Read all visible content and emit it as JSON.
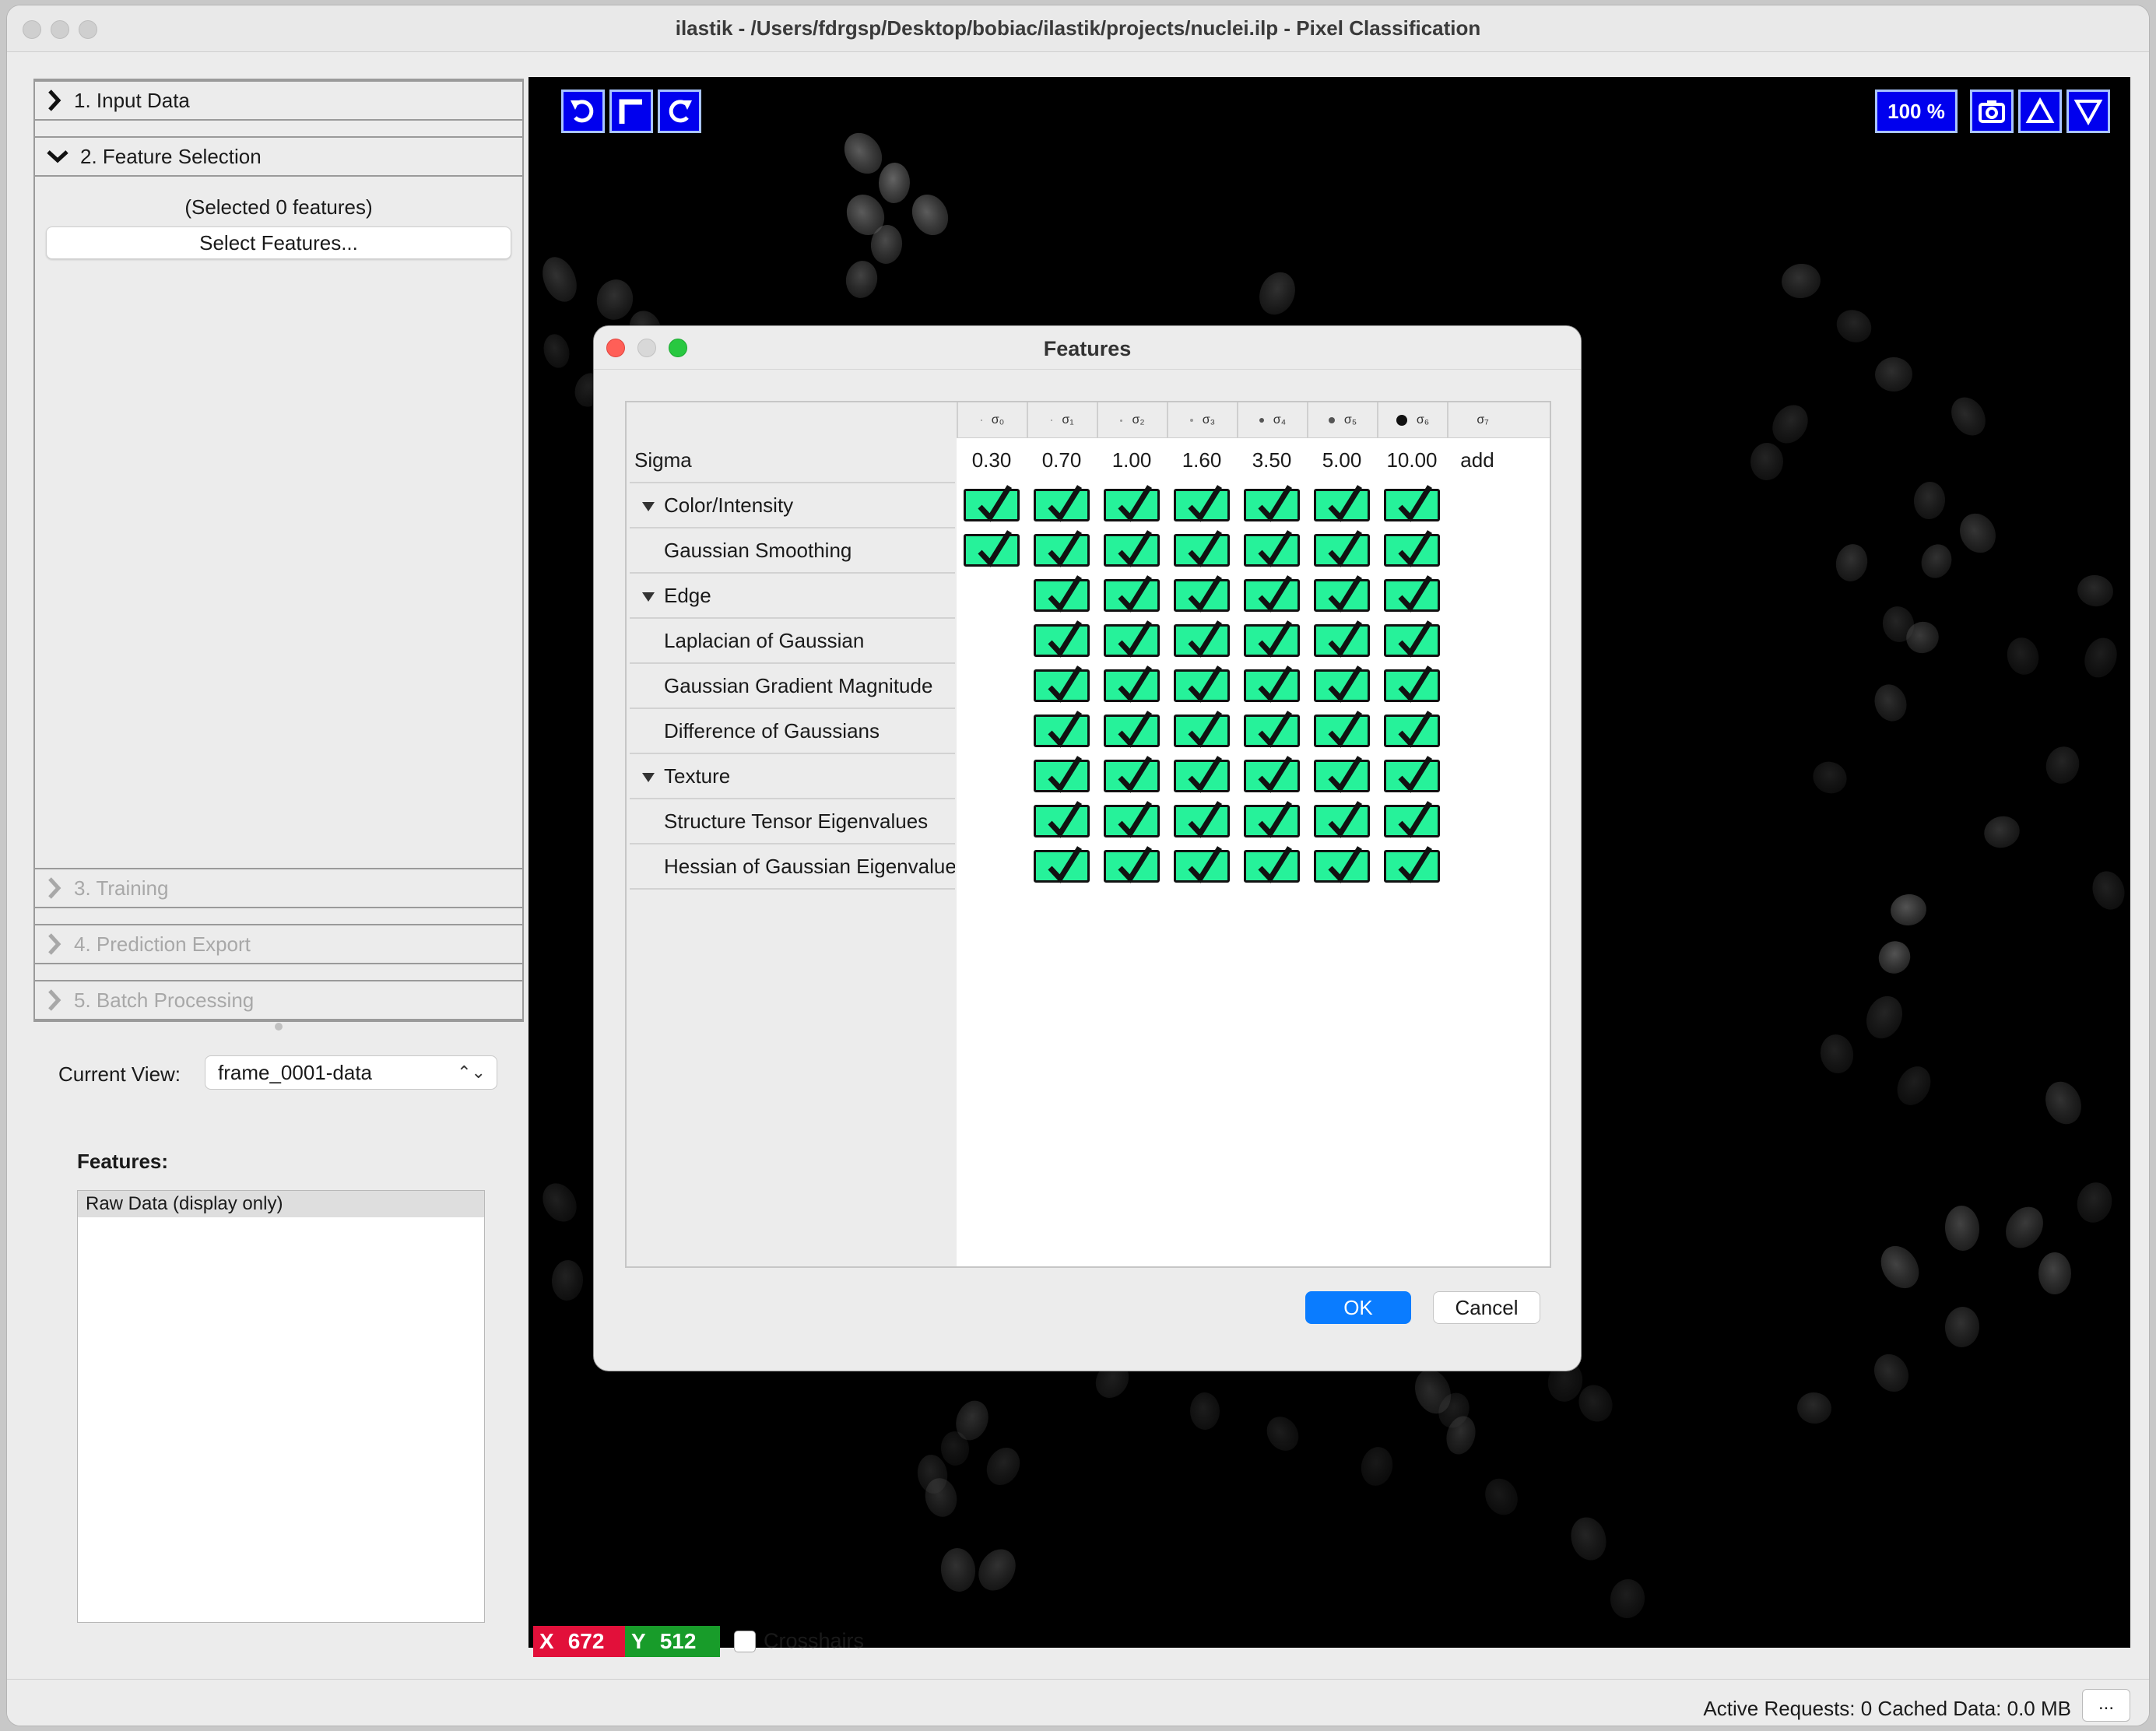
{
  "window": {
    "title": "ilastik - /Users/fdrgsp/Desktop/bobiac/ilastik/projects/nuclei.ilp - Pixel Classification"
  },
  "applets": [
    {
      "label": "1. Input Data",
      "expanded": false,
      "enabled": true
    },
    {
      "label": "2. Feature Selection",
      "expanded": true,
      "enabled": true
    },
    {
      "label": "3. Training",
      "expanded": false,
      "enabled": false
    },
    {
      "label": "4. Prediction Export",
      "expanded": false,
      "enabled": false
    },
    {
      "label": "5. Batch Processing",
      "expanded": false,
      "enabled": false
    }
  ],
  "feature_selection": {
    "selected_count_text": "(Selected 0 features)",
    "select_button": "Select Features..."
  },
  "current_view": {
    "label": "Current View:",
    "value": "frame_0001-data"
  },
  "features_panel": {
    "label": "Features:",
    "items": [
      "Raw Data (display only)"
    ]
  },
  "viewer": {
    "zoom": "100 %",
    "toolbar_icons": [
      "undo-icon",
      "fit-icon",
      "redo-icon"
    ],
    "right_icons": [
      "camera-icon",
      "triangle-up-icon",
      "triangle-down-icon"
    ],
    "accent_color": "#0000ee"
  },
  "coords": {
    "x_label": "X",
    "x_value": "672",
    "y_label": "Y",
    "y_value": "512",
    "crosshairs_label": "Crosshairs",
    "crosshairs_checked": false
  },
  "statusbar": {
    "text": "Active Requests: 0  Cached Data: 0.0 MB",
    "button": "..."
  },
  "dialog": {
    "title": "Features",
    "ok": "OK",
    "cancel": "Cancel",
    "sigma_headers": [
      "σ₀",
      "σ₁",
      "σ₂",
      "σ₃",
      "σ₄",
      "σ₅",
      "σ₆",
      "σ₇"
    ],
    "sigma_label": "Sigma",
    "sigma_values": [
      "0.30",
      "0.70",
      "1.00",
      "1.60",
      "3.50",
      "5.00",
      "10.00",
      "add"
    ],
    "checkbox_color": "#26f29a",
    "rows": [
      {
        "label": "Color/Intensity",
        "group": true,
        "checked": [
          true,
          true,
          true,
          true,
          true,
          true,
          true
        ]
      },
      {
        "label": "Gaussian Smoothing",
        "group": false,
        "checked": [
          true,
          true,
          true,
          true,
          true,
          true,
          true
        ]
      },
      {
        "label": "Edge",
        "group": true,
        "checked": [
          false,
          true,
          true,
          true,
          true,
          true,
          true
        ]
      },
      {
        "label": "Laplacian of Gaussian",
        "group": false,
        "checked": [
          false,
          true,
          true,
          true,
          true,
          true,
          true
        ]
      },
      {
        "label": "Gaussian Gradient Magnitude",
        "group": false,
        "checked": [
          false,
          true,
          true,
          true,
          true,
          true,
          true
        ]
      },
      {
        "label": "Difference of Gaussians",
        "group": false,
        "checked": [
          false,
          true,
          true,
          true,
          true,
          true,
          true
        ]
      },
      {
        "label": "Texture",
        "group": true,
        "checked": [
          false,
          true,
          true,
          true,
          true,
          true,
          true
        ]
      },
      {
        "label": "Structure Tensor Eigenvalues",
        "group": false,
        "checked": [
          false,
          true,
          true,
          true,
          true,
          true,
          true
        ]
      },
      {
        "label": "Hessian of Gaussian Eigenvalue",
        "group": false,
        "checked": [
          false,
          true,
          true,
          true,
          true,
          true,
          true
        ]
      }
    ]
  }
}
